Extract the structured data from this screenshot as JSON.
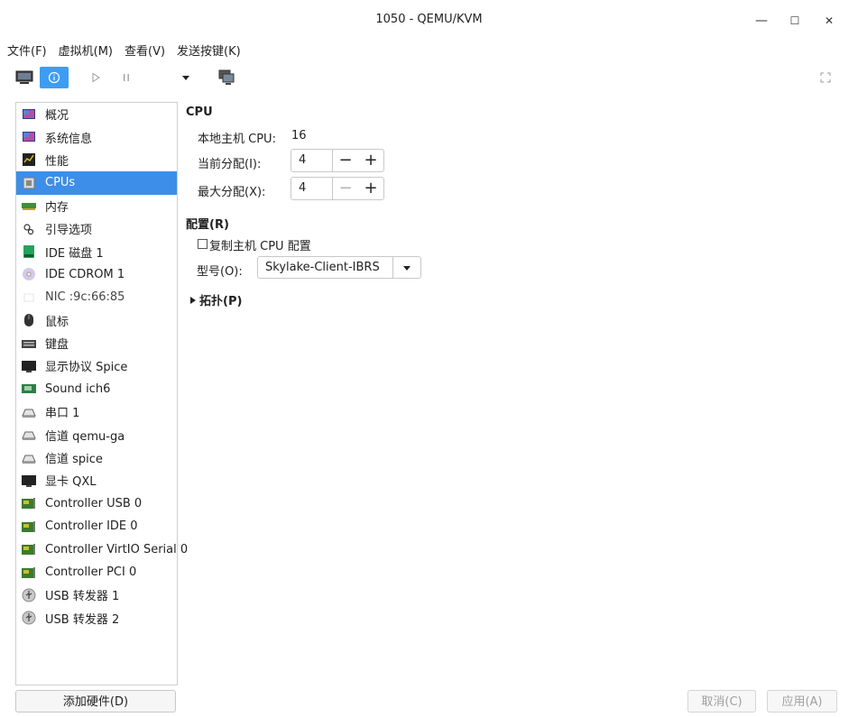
{
  "window": {
    "title": "1050 - QEMU/KVM",
    "minimize": "—",
    "maximize": "☐",
    "close": "✕"
  },
  "menu": [
    "文件(F)",
    "虚拟机(M)",
    "查看(V)",
    "发送按键(K)"
  ],
  "toolbar": {
    "items": [
      "monitor-icon",
      "info-icon",
      "play-icon",
      "pause-icon",
      "dropdown-icon",
      "snapshot-icon",
      "fullscreen-icon"
    ]
  },
  "sidebar": {
    "items": [
      {
        "label": "概况",
        "icon": "overview-icon"
      },
      {
        "label": "系统信息",
        "icon": "sysinfo-icon"
      },
      {
        "label": "性能",
        "icon": "performance-icon"
      },
      {
        "label": "CPUs",
        "icon": "cpu-icon",
        "selected": true
      },
      {
        "label": "内存",
        "icon": "memory-icon"
      },
      {
        "label": "引导选项",
        "icon": "boot-icon"
      },
      {
        "label": "IDE 磁盘 1",
        "icon": "disk-icon"
      },
      {
        "label": "IDE CDROM 1",
        "icon": "cdrom-icon"
      },
      {
        "label": "NIC :9c:66:85",
        "icon": "nic-icon"
      },
      {
        "label": "鼠标",
        "icon": "mouse-icon"
      },
      {
        "label": "键盘",
        "icon": "keyboard-icon"
      },
      {
        "label": "显示协议 Spice",
        "icon": "display-icon"
      },
      {
        "label": "Sound ich6",
        "icon": "sound-icon"
      },
      {
        "label": "串口 1",
        "icon": "serial-icon"
      },
      {
        "label": "信道 qemu-ga",
        "icon": "channel-icon"
      },
      {
        "label": "信道 spice",
        "icon": "channel-icon"
      },
      {
        "label": "显卡 QXL",
        "icon": "video-icon"
      },
      {
        "label": "Controller USB 0",
        "icon": "controller-icon"
      },
      {
        "label": "Controller IDE 0",
        "icon": "controller-icon"
      },
      {
        "label": "Controller VirtIO Serial 0",
        "icon": "controller-icon"
      },
      {
        "label": "Controller PCI 0",
        "icon": "controller-icon"
      },
      {
        "label": "USB 转发器 1",
        "icon": "usb-redir-icon"
      },
      {
        "label": "USB 转发器 2",
        "icon": "usb-redir-icon"
      }
    ],
    "add_hardware": "添加硬件(D)"
  },
  "cpu": {
    "heading": "CPU",
    "host_cpu_label": "本地主机 CPU:",
    "host_cpu_value": "16",
    "current_label": "当前分配(I):",
    "current_value": "4",
    "max_label": "最大分配(X):",
    "max_value": "4",
    "minus": "−",
    "plus": "+"
  },
  "config": {
    "heading": "配置(R)",
    "copy_host_label": "复制主机 CPU 配置",
    "copy_host_checked": false,
    "model_label": "型号(O):",
    "model_value": "Skylake-Client-IBRS"
  },
  "topology": {
    "label": "拓扑(P)"
  },
  "footer": {
    "cancel": "取消(C)",
    "apply": "应用(A)"
  }
}
